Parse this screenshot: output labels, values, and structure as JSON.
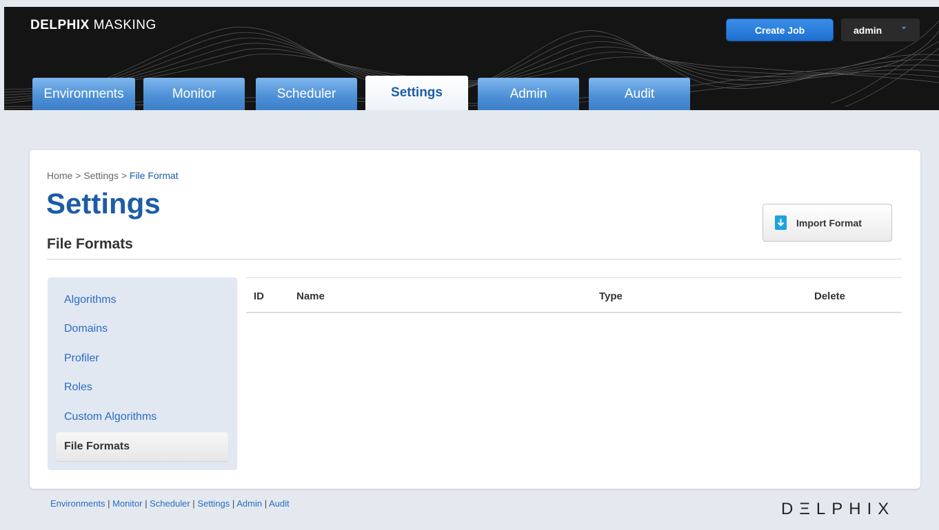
{
  "header": {
    "brand_bold": "DELPHIX",
    "brand_thin": "MASKING",
    "create_job_label": "Create Job",
    "user_label": "admin"
  },
  "tabs": [
    {
      "label": "Environments"
    },
    {
      "label": "Monitor"
    },
    {
      "label": "Scheduler"
    },
    {
      "label": "Settings",
      "active": true
    },
    {
      "label": "Admin"
    },
    {
      "label": "Audit"
    }
  ],
  "breadcrumb": {
    "home": "Home",
    "separator": ">",
    "settings": "Settings",
    "current": "File Format"
  },
  "page": {
    "title": "Settings",
    "subtitle": "File Formats",
    "import_label": "Import Format",
    "import_icon": "download-icon"
  },
  "sidebar": {
    "items": [
      {
        "label": "Algorithms"
      },
      {
        "label": "Domains"
      },
      {
        "label": "Profiler"
      },
      {
        "label": "Roles"
      },
      {
        "label": "Custom Algorithms"
      },
      {
        "label": "File Formats",
        "active": true
      }
    ]
  },
  "table": {
    "columns": [
      "ID",
      "Name",
      "Type",
      "Delete"
    ],
    "rows": []
  },
  "footer": {
    "links": [
      "Environments",
      "Monitor",
      "Scheduler",
      "Settings",
      "Admin",
      "Audit"
    ],
    "separator": "|",
    "logo": "DΞLPHIX"
  },
  "colors": {
    "accent": "#1d5ca6",
    "link": "#2a6bc2",
    "primary_button": "#1f6fd0",
    "header_bg": "#141414"
  }
}
